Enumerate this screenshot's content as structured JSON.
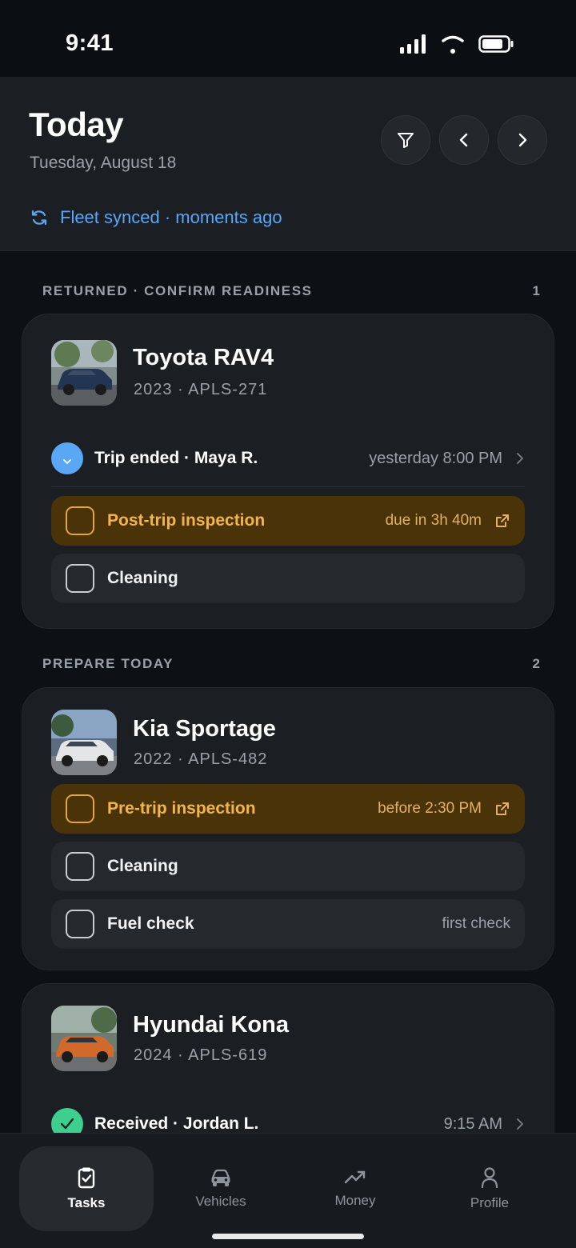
{
  "status_bar": {
    "time": "9:41"
  },
  "header": {
    "title": "Today",
    "date": "Tuesday, August 18",
    "sync_text": "Fleet synced · moments ago"
  },
  "sections": [
    {
      "label": "RETURNED · CONFIRM READINESS",
      "count": "1",
      "vehicles": [
        {
          "name": "Toyota RAV4",
          "meta": "2023 · APLS-271",
          "event": {
            "text": "Trip ended · Maya R.",
            "time": "yesterday 8:00 PM",
            "icon": "chevron-down-icon"
          },
          "tasks": [
            {
              "label": "Post-trip inspection",
              "note": "due in 3h 40m",
              "urgent": true
            },
            {
              "label": "Cleaning",
              "note": ""
            }
          ]
        }
      ]
    },
    {
      "label": "PREPARE TODAY",
      "count": "2",
      "vehicles": [
        {
          "name": "Kia Sportage",
          "meta": "2022 · APLS-482",
          "tasks": [
            {
              "label": "Pre-trip inspection",
              "note": "before 2:30 PM",
              "urgent": true
            },
            {
              "label": "Cleaning",
              "note": ""
            },
            {
              "label": "Fuel check",
              "note": "first check"
            }
          ]
        },
        {
          "name": "Hyundai Kona",
          "meta": "2024 · APLS-619",
          "event": {
            "text": "Received · Jordan L.",
            "time": "9:15 AM",
            "icon": "check-icon"
          }
        }
      ]
    }
  ],
  "nav": {
    "items": [
      {
        "label": "Tasks",
        "icon": "clipboard-check-icon",
        "active": true
      },
      {
        "label": "Vehicles",
        "icon": "car-icon"
      },
      {
        "label": "Money",
        "icon": "trend-up-icon"
      },
      {
        "label": "Profile",
        "icon": "person-icon"
      }
    ]
  },
  "colors": {
    "accent_blue": "#5aa7f5",
    "urgent_bg": "#4b3309",
    "urgent_text": "#f3b54a",
    "success_green": "#3ecf8e"
  }
}
